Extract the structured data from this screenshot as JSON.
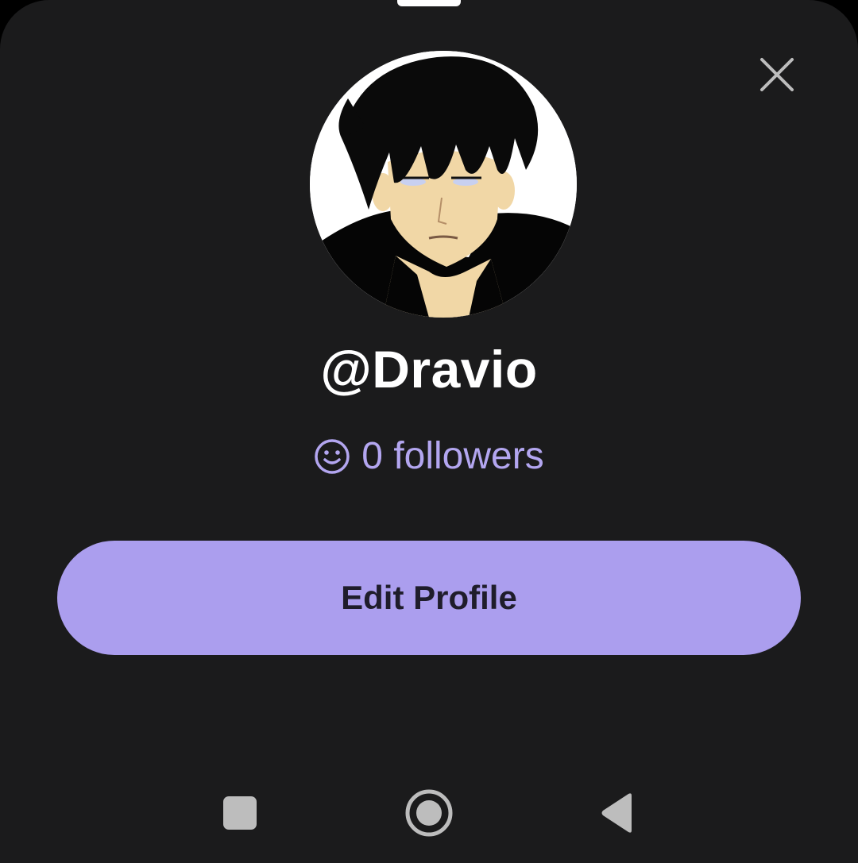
{
  "profile": {
    "username": "@Dravio",
    "followers_text": "0 followers",
    "avatar_description": "anime-style dark-haired character portrait"
  },
  "actions": {
    "edit_profile_label": "Edit Profile"
  },
  "icons": {
    "close": "close-icon",
    "followers": "smiley-icon",
    "nav_recents": "square-icon",
    "nav_home": "circle-icon",
    "nav_back": "triangle-back-icon"
  },
  "colors": {
    "sheet_background": "#1b1b1c",
    "accent": "#ab9eee",
    "accent_text": "#b3a6f0",
    "button_text": "#1f1d2b",
    "nav_icon": "#bdbdbd"
  }
}
